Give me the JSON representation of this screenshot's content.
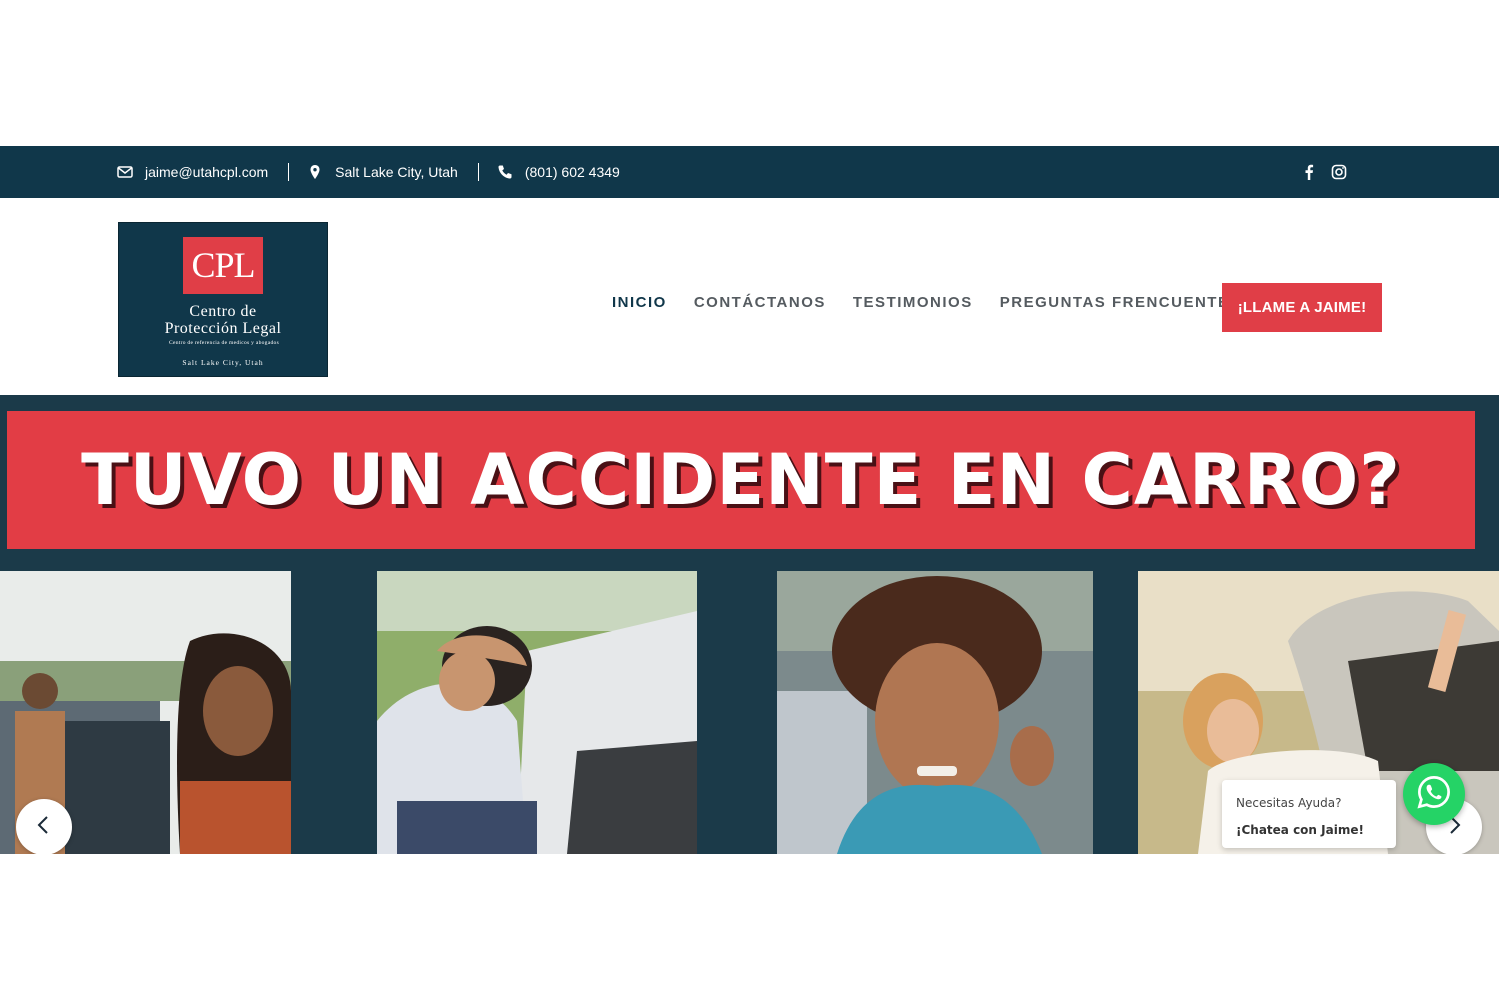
{
  "topbar": {
    "email": "jaime@utahcpl.com",
    "location": "Salt Lake City, Utah",
    "phone": "(801) 602 4349",
    "social": [
      "facebook-icon",
      "instagram-icon"
    ]
  },
  "logo": {
    "mark": "CPL",
    "line1": "Centro de",
    "line2": "Protección Legal",
    "line3": "Centro de referencia de medicos y abogados",
    "line4": "Salt Lake City, Utah"
  },
  "nav": {
    "items": [
      "INICIO",
      "CONTÁCTANOS",
      "TESTIMONIOS",
      "PREGUNTAS FRENCUENTES"
    ],
    "active": "INICIO",
    "cta": "¡LLAME A JAIME!"
  },
  "hero": {
    "headline": "TUVO UN ACCIDENTE EN CARRO?"
  },
  "chat": {
    "prefix": "Necesitas Ayuda?",
    "bold": "¡Chatea con Jaime!"
  },
  "colors": {
    "navy": "#10374a",
    "accent_red": "#e03e47",
    "whatsapp": "#25d366"
  }
}
